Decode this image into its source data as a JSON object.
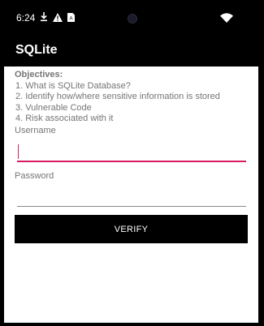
{
  "status_bar": {
    "time": "6:24",
    "icons": [
      "download-icon",
      "warning-icon",
      "sim-icon",
      "wifi-icon"
    ]
  },
  "app_bar": {
    "title": "SQLite"
  },
  "objectives": {
    "heading": "Objectives:",
    "items": [
      "1. What is SQLite Database?",
      "2. Identify how/where sensitive information is stored",
      "3. Vulnerable Code",
      "4. Risk associated with it"
    ]
  },
  "form": {
    "username_label": "Username",
    "username_value": "",
    "password_label": "Password",
    "password_value": "",
    "verify_label": "VERIFY"
  },
  "colors": {
    "accent": "#d81b60",
    "label_text": "#757575",
    "app_bar": "#000000",
    "button": "#000000"
  }
}
